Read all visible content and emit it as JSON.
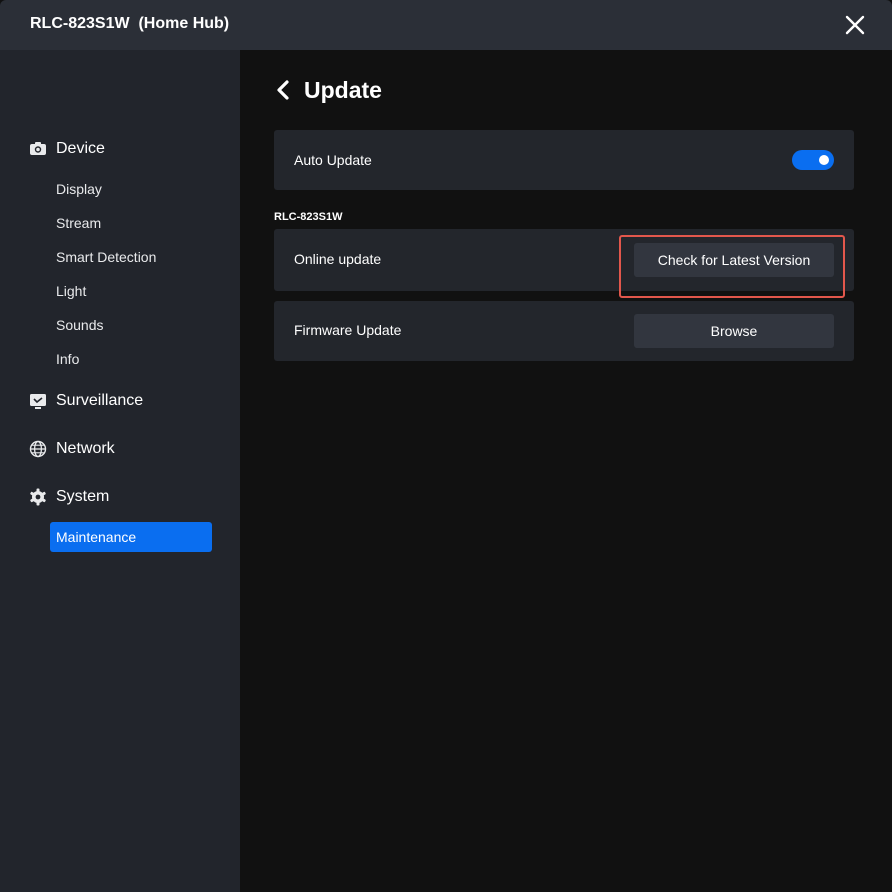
{
  "window": {
    "title": "RLC-823S1W  (Home Hub)"
  },
  "sidebar": {
    "sections": [
      {
        "label": "Device",
        "icon": "camera-icon"
      },
      {
        "label": "Surveillance",
        "icon": "monitor-icon"
      },
      {
        "label": "Network",
        "icon": "globe-icon"
      },
      {
        "label": "System",
        "icon": "gear-icon"
      }
    ],
    "device_items": [
      "Display",
      "Stream",
      "Smart Detection",
      "Light",
      "Sounds",
      "Info"
    ],
    "system_items": [
      "Maintenance"
    ],
    "active_item": "Maintenance"
  },
  "main": {
    "page_title": "Update",
    "auto_update": {
      "label": "Auto Update",
      "enabled": true
    },
    "device_name": "RLC-823S1W",
    "online_update": {
      "label": "Online update",
      "button": "Check for Latest Version"
    },
    "firmware_update": {
      "label": "Firmware Update",
      "button": "Browse"
    }
  },
  "colors": {
    "accent": "#0a6ef0",
    "highlight": "#e2574c",
    "sidebar_bg": "#22252c",
    "titlebar_bg": "#2b2f37",
    "card_bg": "#23262c"
  }
}
